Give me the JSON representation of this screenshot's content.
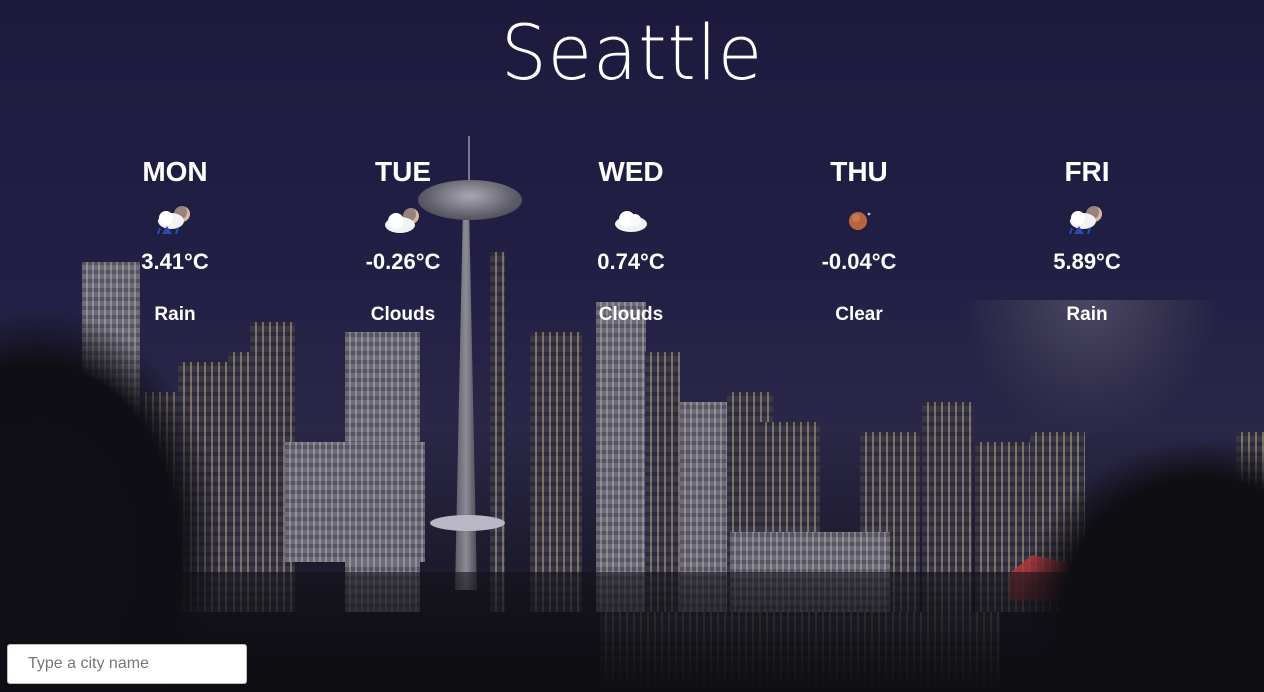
{
  "city": {
    "name": "Seattle"
  },
  "forecast": {
    "days": [
      {
        "day": "MON",
        "temp": "3.41°C",
        "condition": "Rain",
        "icon": "rain-cloud-moon-icon"
      },
      {
        "day": "TUE",
        "temp": "-0.26°C",
        "condition": "Clouds",
        "icon": "cloud-moon-icon"
      },
      {
        "day": "WED",
        "temp": "0.74°C",
        "condition": "Clouds",
        "icon": "cloud-icon"
      },
      {
        "day": "THU",
        "temp": "-0.04°C",
        "condition": "Clear",
        "icon": "moon-icon"
      },
      {
        "day": "FRI",
        "temp": "5.89°C",
        "condition": "Rain",
        "icon": "rain-cloud-moon-icon"
      }
    ]
  },
  "search": {
    "placeholder": "Type a city name",
    "value": ""
  },
  "colors": {
    "text": "#ffffff",
    "background": "#1f1c3d",
    "input_border": "#bfbfbf"
  }
}
